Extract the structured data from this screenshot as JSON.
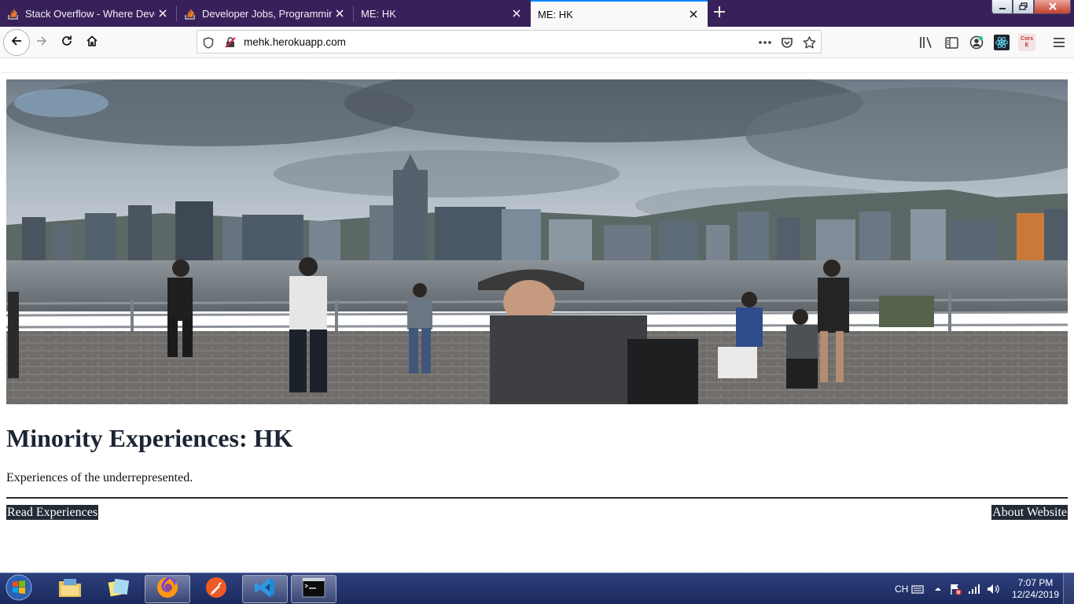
{
  "browser": {
    "tabs": [
      {
        "title": "Stack Overflow - Where Develo",
        "favicon": "stackoverflow-icon",
        "active": false
      },
      {
        "title": "Developer Jobs, Programming",
        "favicon": "stackoverflow-icon",
        "active": false
      },
      {
        "title": "ME: HK",
        "favicon": "",
        "active": false
      },
      {
        "title": "ME: HK",
        "favicon": "",
        "active": true
      }
    ],
    "url": "mehk.herokuapp.com",
    "toolbar_icons": [
      "library-icon",
      "sidebar-icon",
      "account-icon",
      "react-devtools-icon",
      "cors-extension-icon",
      "menu-icon"
    ],
    "cors_extension_label": "Cors E"
  },
  "page": {
    "hero_image": "hong-kong-harbour-skyline-photo",
    "heading": "Minority Experiences: HK",
    "tagline": "Experiences of the underrepresented.",
    "read_button": "Read Experiences",
    "about_button": "About Website"
  },
  "taskbar": {
    "apps": [
      "file-explorer-icon",
      "sticky-notes-icon",
      "firefox-icon",
      "postman-icon",
      "vscode-icon",
      "command-prompt-icon"
    ],
    "input_language": "CH",
    "time": "7:07 PM",
    "date": "12/24/2019"
  },
  "colors": {
    "tabstrip": "#38215a",
    "accent": "#0a84ff",
    "button_bg": "#232b36",
    "taskbar": "#1b2a5e"
  }
}
